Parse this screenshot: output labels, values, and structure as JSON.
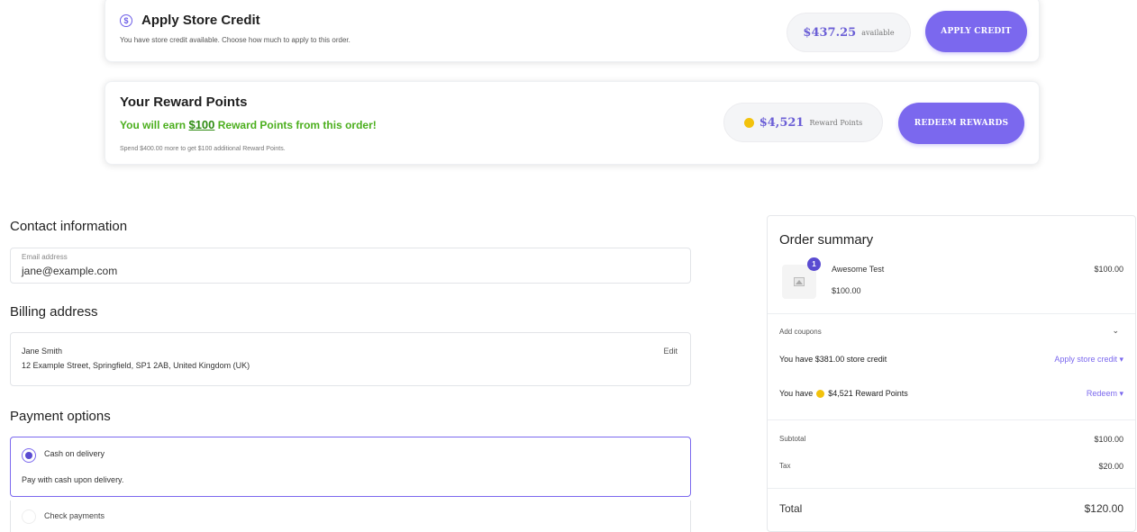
{
  "store_credit": {
    "title": "Apply Store Credit",
    "icon": "dollar-circle-icon",
    "subtitle": "You have store credit available. Choose how much to apply to this order.",
    "amount": "$437.25",
    "amount_label": "available",
    "button_label": "APPLY CREDIT"
  },
  "rewards": {
    "title": "Your Reward Points",
    "earn_prefix": "You will earn ",
    "earn_amount": "$100",
    "earn_suffix": " Reward Points from this order!",
    "subtitle": "Spend $400.00 more to get $100 additional Reward Points.",
    "points_value": "$4,521",
    "points_label": "Reward Points",
    "button_label": "REDEEM REWARDS"
  },
  "contact": {
    "heading": "Contact information",
    "email_label": "Email address",
    "email_value": "jane@example.com"
  },
  "billing": {
    "heading": "Billing address",
    "name": "Jane Smith",
    "address": "12 Example Street, Springfield, SP1 2AB, United Kingdom (UK)",
    "edit_label": "Edit"
  },
  "payment": {
    "heading": "Payment options",
    "options": [
      {
        "label": "Cash on delivery",
        "description": "Pay with cash upon delivery.",
        "selected": true
      },
      {
        "label": "Check payments",
        "selected": false
      }
    ]
  },
  "order_summary": {
    "title": "Order summary",
    "item": {
      "quantity": "1",
      "name": "Awesome Test",
      "unit_price": "$100.00",
      "price": "$100.00"
    },
    "add_coupons": "Add coupons",
    "store_credit_text": "You have $381.00 store credit",
    "store_credit_link": "Apply store credit",
    "reward_prefix": "You have",
    "reward_text": "$4,521 Reward Points",
    "reward_link": "Redeem",
    "subtotal_label": "Subtotal",
    "subtotal_value": "$100.00",
    "tax_label": "Tax",
    "tax_value": "$20.00",
    "total_label": "Total",
    "total_value": "$120.00"
  },
  "colors": {
    "accent": "#7b68ee",
    "earn_green": "#4caf1e",
    "coin": "#f2c20c"
  }
}
